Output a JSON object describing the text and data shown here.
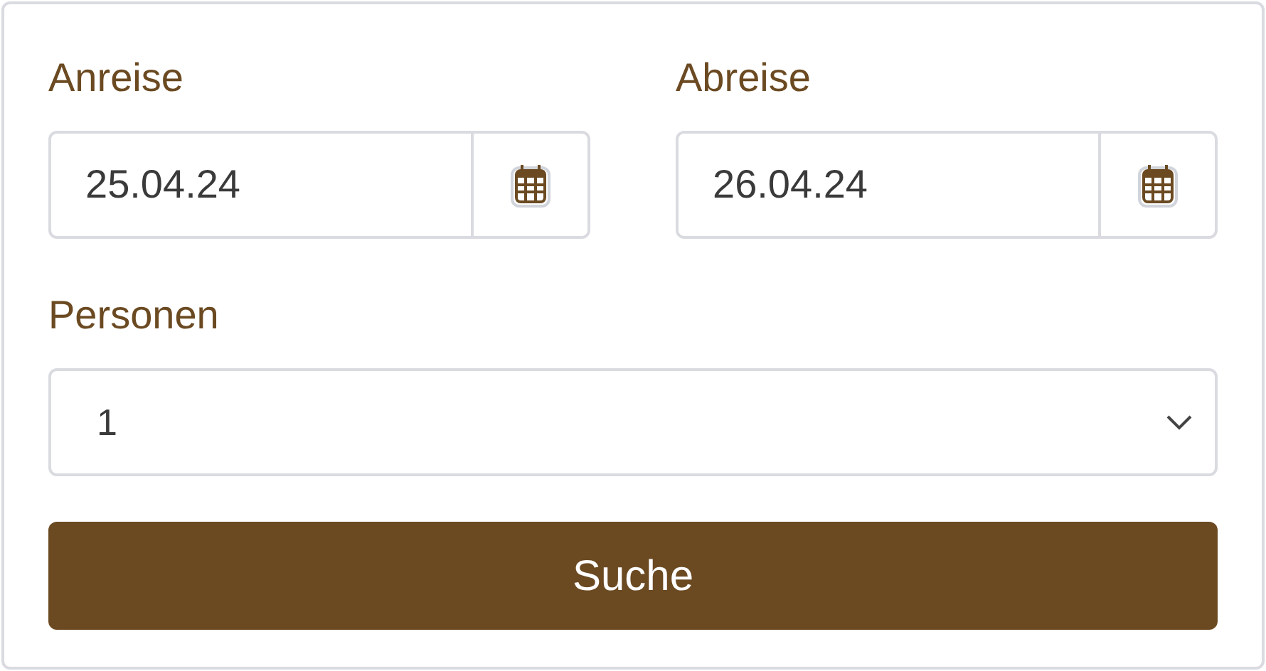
{
  "dates": [
    {
      "label": "Anreise",
      "value": "25.04.24"
    },
    {
      "label": "Abreise",
      "value": "26.04.24"
    }
  ],
  "persons": {
    "label": "Personen",
    "value": "1"
  },
  "button": "Suche"
}
